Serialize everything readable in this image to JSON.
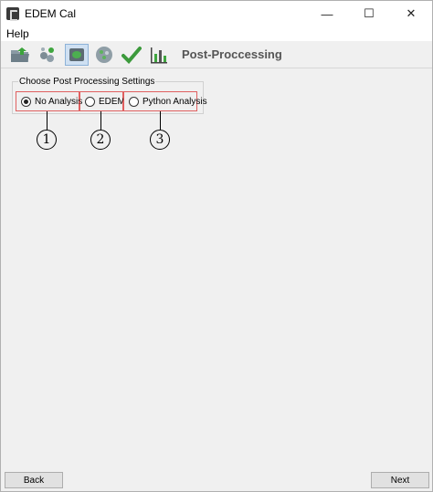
{
  "window": {
    "title": "EDEM Cal",
    "controls": {
      "minimize": "—",
      "maximize": "☐",
      "close": "✕"
    }
  },
  "menu": {
    "items": [
      "Help"
    ]
  },
  "toolbar": {
    "title": "Post-Proccessing",
    "buttons": [
      {
        "icon": "folder-icon"
      },
      {
        "icon": "particles-icon"
      },
      {
        "icon": "database-icon",
        "active": true
      },
      {
        "icon": "sphere-cluster-icon"
      },
      {
        "icon": "checkmark-icon"
      },
      {
        "icon": "bar-chart-icon"
      }
    ]
  },
  "settings": {
    "group_label": "Choose Post Processing Settings",
    "options": [
      {
        "label": "No Analysis",
        "checked": true,
        "marker": "1"
      },
      {
        "label": "EDEM",
        "checked": false,
        "marker": "2"
      },
      {
        "label": "Python Analysis",
        "checked": false,
        "marker": "3"
      }
    ]
  },
  "footer": {
    "back_label": "Back",
    "next_label": "Next"
  },
  "colors": {
    "annotation_box": "#e06060",
    "active_tool": "#cfe0f2"
  }
}
